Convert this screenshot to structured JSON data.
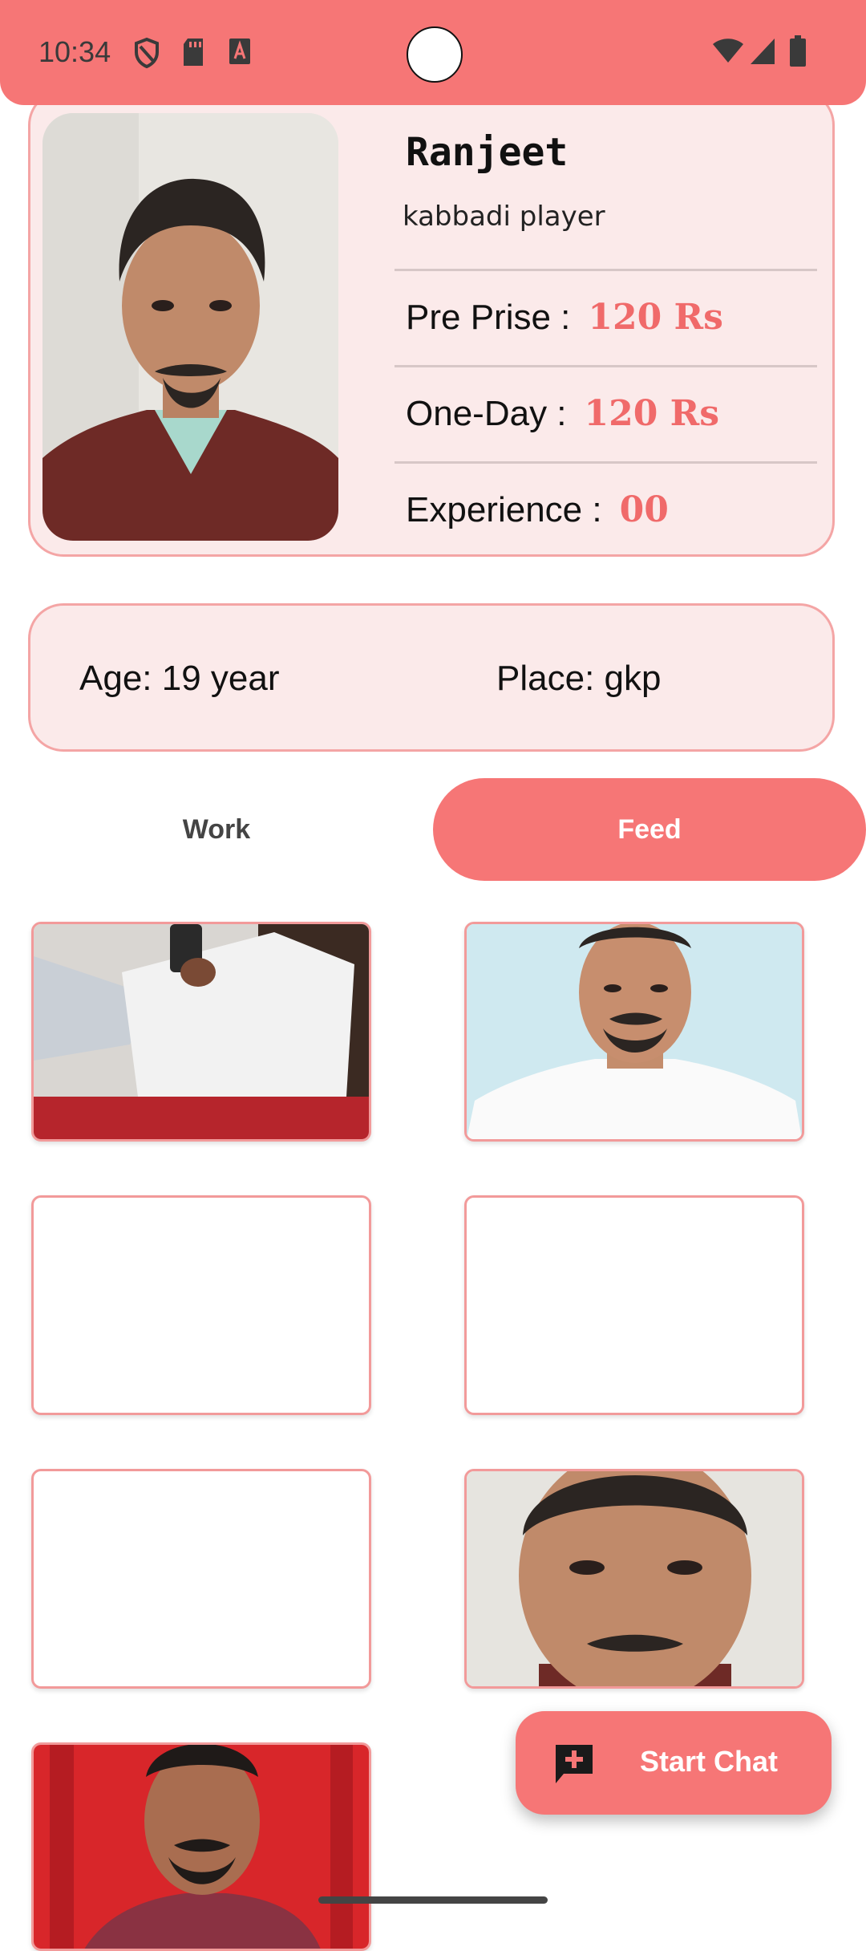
{
  "status_bar": {
    "time": "10:34"
  },
  "profile": {
    "name": "Ranjeet",
    "role": "kabbadi player",
    "pre_price_label": "Pre Prise :",
    "pre_price_value": "120 Rs",
    "one_day_label": "One-Day :",
    "one_day_value": "120 Rs",
    "experience_label": "Experience :",
    "experience_value": "00"
  },
  "info": {
    "age": "Age: 19 year",
    "place": "Place: gkp"
  },
  "tabs": [
    {
      "label": "Work",
      "selected": false
    },
    {
      "label": "Feed",
      "selected": true
    }
  ],
  "fab": {
    "label": "Start Chat",
    "icon": "add-chat-icon"
  },
  "colors": {
    "accent": "#f67676",
    "card_bg": "#fbeaea",
    "card_border": "#f4a5a5",
    "price": "#f06a6a"
  }
}
